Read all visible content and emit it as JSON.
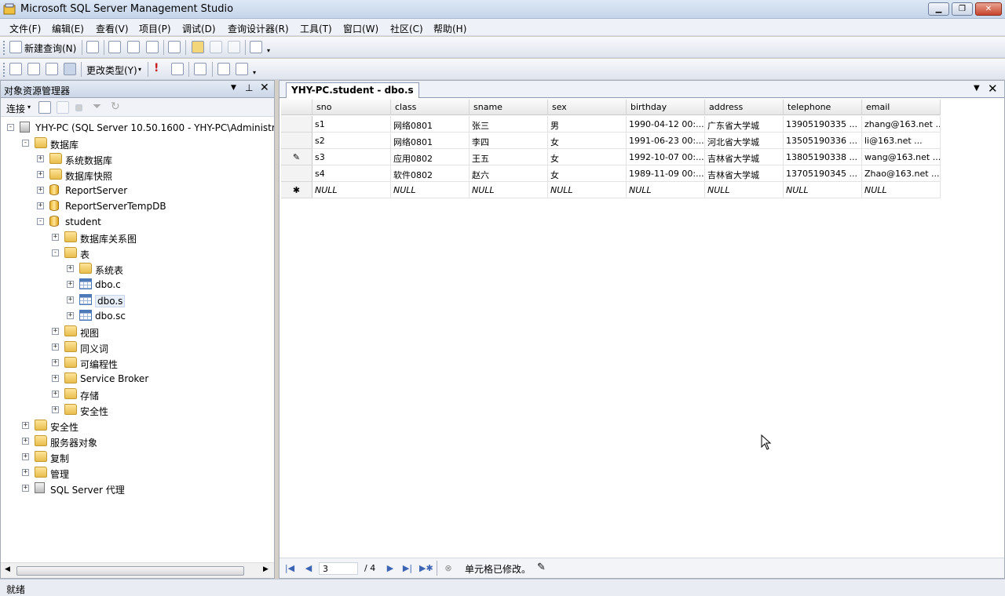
{
  "window": {
    "title": "Microsoft SQL Server Management Studio"
  },
  "menu": [
    "文件(F)",
    "编辑(E)",
    "查看(V)",
    "项目(P)",
    "调试(D)",
    "查询设计器(R)",
    "工具(T)",
    "窗口(W)",
    "社区(C)",
    "帮助(H)"
  ],
  "toolbar1": {
    "new_query": "新建查询(N)"
  },
  "toolbar2": {
    "change_type": "更改类型(Y)"
  },
  "explorer": {
    "title": "对象资源管理器",
    "connect": "连接",
    "tree": [
      {
        "label": "YHY-PC (SQL Server 10.50.1600 - YHY-PC\\Administrator)",
        "level": 0,
        "icon": "server-icon",
        "exp": "-"
      },
      {
        "label": "数据库",
        "level": 1,
        "icon": "folder-icon",
        "exp": "-"
      },
      {
        "label": "系统数据库",
        "level": 2,
        "icon": "folder-icon",
        "exp": "+"
      },
      {
        "label": "数据库快照",
        "level": 2,
        "icon": "folder-icon",
        "exp": "+"
      },
      {
        "label": "ReportServer",
        "level": 2,
        "icon": "database-icon",
        "exp": "+"
      },
      {
        "label": "ReportServerTempDB",
        "level": 2,
        "icon": "database-icon",
        "exp": "+"
      },
      {
        "label": "student",
        "level": 2,
        "icon": "database-icon",
        "exp": "-"
      },
      {
        "label": "数据库关系图",
        "level": 3,
        "icon": "folder-icon",
        "exp": "+"
      },
      {
        "label": "表",
        "level": 3,
        "icon": "folder-icon",
        "exp": "-"
      },
      {
        "label": "系统表",
        "level": 4,
        "icon": "folder-icon",
        "exp": "+"
      },
      {
        "label": "dbo.c",
        "level": 4,
        "icon": "table-icon",
        "exp": "+"
      },
      {
        "label": "dbo.s",
        "level": 4,
        "icon": "table-icon",
        "exp": "+",
        "selected": true
      },
      {
        "label": "dbo.sc",
        "level": 4,
        "icon": "table-icon",
        "exp": "+"
      },
      {
        "label": "视图",
        "level": 3,
        "icon": "folder-icon",
        "exp": "+"
      },
      {
        "label": "同义词",
        "level": 3,
        "icon": "folder-icon",
        "exp": "+"
      },
      {
        "label": "可编程性",
        "level": 3,
        "icon": "folder-icon",
        "exp": "+"
      },
      {
        "label": "Service Broker",
        "level": 3,
        "icon": "folder-icon",
        "exp": "+"
      },
      {
        "label": "存储",
        "level": 3,
        "icon": "folder-icon",
        "exp": "+"
      },
      {
        "label": "安全性",
        "level": 3,
        "icon": "folder-icon",
        "exp": "+"
      },
      {
        "label": "安全性",
        "level": 1,
        "icon": "folder-icon",
        "exp": "+"
      },
      {
        "label": "服务器对象",
        "level": 1,
        "icon": "folder-icon",
        "exp": "+"
      },
      {
        "label": "复制",
        "level": 1,
        "icon": "folder-icon",
        "exp": "+"
      },
      {
        "label": "管理",
        "level": 1,
        "icon": "folder-icon",
        "exp": "+"
      },
      {
        "label": "SQL Server 代理",
        "level": 1,
        "icon": "agent-icon",
        "exp": "+"
      }
    ]
  },
  "document": {
    "tab": "YHY-PC.student - dbo.s",
    "columns": [
      "sno",
      "class",
      "sname",
      "sex",
      "birthday",
      "address",
      "telephone",
      "email"
    ],
    "rows": [
      {
        "marker": "",
        "cells": [
          "s1",
          "网络0801",
          "张三",
          "男",
          "1990-04-12 00:...",
          "广东省大学城",
          "13905190335   ...",
          "zhang@163.net ..."
        ]
      },
      {
        "marker": "",
        "cells": [
          "s2",
          "网络0801",
          "李四",
          "女",
          "1991-06-23 00:...",
          "河北省大学城",
          "13505190336   ...",
          "li@163.net      ..."
        ]
      },
      {
        "marker": "✎",
        "cells": [
          "s3",
          "应用0802",
          "王五",
          "女",
          "1992-10-07 00:...",
          "吉林省大学城",
          "13805190338   ...",
          "wang@163.net  ..."
        ]
      },
      {
        "marker": "",
        "cells": [
          "s4",
          "软件0802",
          "赵六",
          "女",
          "1989-11-09 00:...",
          "吉林省大学城",
          "13705190345   ...",
          "Zhao@163.net  ..."
        ]
      },
      {
        "marker": "✱",
        "cells": [
          "NULL",
          "NULL",
          "NULL",
          "NULL",
          "NULL",
          "NULL",
          "NULL",
          "NULL"
        ],
        "null": true
      }
    ],
    "nav": {
      "current": "3",
      "total": "/ 4",
      "status": "单元格已修改。"
    }
  },
  "status": "就绪"
}
